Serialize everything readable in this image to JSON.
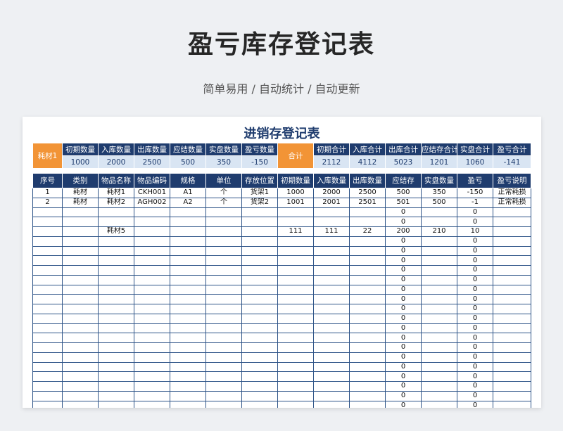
{
  "page": {
    "title": "盈亏库存登记表",
    "subtitle": "简单易用 / 自动统计 / 自动更新"
  },
  "sheet": {
    "title": "进销存登记表",
    "summary_left": {
      "name": "耗材1",
      "labels": [
        "初期数量",
        "入库数量",
        "出库数量",
        "应结数量",
        "实盘数量",
        "盈亏数量"
      ],
      "values": [
        "1000",
        "2000",
        "2500",
        "500",
        "350",
        "-150"
      ]
    },
    "summary_right": {
      "name": "合计",
      "labels": [
        "初期合计",
        "入库合计",
        "出库合计",
        "应结存合计",
        "实盘合计",
        "盈亏合计"
      ],
      "values": [
        "2112",
        "4112",
        "5023",
        "1201",
        "1060",
        "-141"
      ]
    },
    "columns": [
      "序号",
      "类别",
      "物品名称",
      "物品编码",
      "规格",
      "单位",
      "存放位置",
      "初期数量",
      "入库数量",
      "出库数量",
      "应结存",
      "实盘数量",
      "盈亏",
      "盈亏说明"
    ],
    "rows": [
      [
        "1",
        "耗材",
        "耗材1",
        "CKH001",
        "A1",
        "个",
        "货架1",
        "1000",
        "2000",
        "2500",
        "500",
        "350",
        "-150",
        "正常耗损"
      ],
      [
        "2",
        "耗材",
        "耗材2",
        "AGH002",
        "A2",
        "个",
        "货架2",
        "1001",
        "2001",
        "2501",
        "501",
        "500",
        "-1",
        "正常耗损"
      ],
      [
        "",
        "",
        "",
        "",
        "",
        "",
        "",
        "",
        "",
        "",
        "0",
        "",
        "0",
        ""
      ],
      [
        "",
        "",
        "",
        "",
        "",
        "",
        "",
        "",
        "",
        "",
        "0",
        "",
        "0",
        ""
      ],
      [
        "",
        "",
        "耗材5",
        "",
        "",
        "",
        "",
        "111",
        "111",
        "22",
        "200",
        "210",
        "10",
        ""
      ],
      [
        "",
        "",
        "",
        "",
        "",
        "",
        "",
        "",
        "",
        "",
        "0",
        "",
        "0",
        ""
      ],
      [
        "",
        "",
        "",
        "",
        "",
        "",
        "",
        "",
        "",
        "",
        "0",
        "",
        "0",
        ""
      ],
      [
        "",
        "",
        "",
        "",
        "",
        "",
        "",
        "",
        "",
        "",
        "0",
        "",
        "0",
        ""
      ],
      [
        "",
        "",
        "",
        "",
        "",
        "",
        "",
        "",
        "",
        "",
        "0",
        "",
        "0",
        ""
      ],
      [
        "",
        "",
        "",
        "",
        "",
        "",
        "",
        "",
        "",
        "",
        "0",
        "",
        "0",
        ""
      ],
      [
        "",
        "",
        "",
        "",
        "",
        "",
        "",
        "",
        "",
        "",
        "0",
        "",
        "0",
        ""
      ],
      [
        "",
        "",
        "",
        "",
        "",
        "",
        "",
        "",
        "",
        "",
        "0",
        "",
        "0",
        ""
      ],
      [
        "",
        "",
        "",
        "",
        "",
        "",
        "",
        "",
        "",
        "",
        "0",
        "",
        "0",
        ""
      ],
      [
        "",
        "",
        "",
        "",
        "",
        "",
        "",
        "",
        "",
        "",
        "0",
        "",
        "0",
        ""
      ],
      [
        "",
        "",
        "",
        "",
        "",
        "",
        "",
        "",
        "",
        "",
        "0",
        "",
        "0",
        ""
      ],
      [
        "",
        "",
        "",
        "",
        "",
        "",
        "",
        "",
        "",
        "",
        "0",
        "",
        "0",
        ""
      ],
      [
        "",
        "",
        "",
        "",
        "",
        "",
        "",
        "",
        "",
        "",
        "0",
        "",
        "0",
        ""
      ],
      [
        "",
        "",
        "",
        "",
        "",
        "",
        "",
        "",
        "",
        "",
        "0",
        "",
        "0",
        ""
      ],
      [
        "",
        "",
        "",
        "",
        "",
        "",
        "",
        "",
        "",
        "",
        "0",
        "",
        "0",
        ""
      ],
      [
        "",
        "",
        "",
        "",
        "",
        "",
        "",
        "",
        "",
        "",
        "0",
        "",
        "0",
        ""
      ],
      [
        "",
        "",
        "",
        "",
        "",
        "",
        "",
        "",
        "",
        "",
        "0",
        "",
        "0",
        ""
      ],
      [
        "",
        "",
        "",
        "",
        "",
        "",
        "",
        "",
        "",
        "",
        "0",
        "",
        "0",
        ""
      ],
      [
        "",
        "",
        "",
        "",
        "",
        "",
        "",
        "",
        "",
        "",
        "0",
        "",
        "0",
        ""
      ]
    ]
  }
}
